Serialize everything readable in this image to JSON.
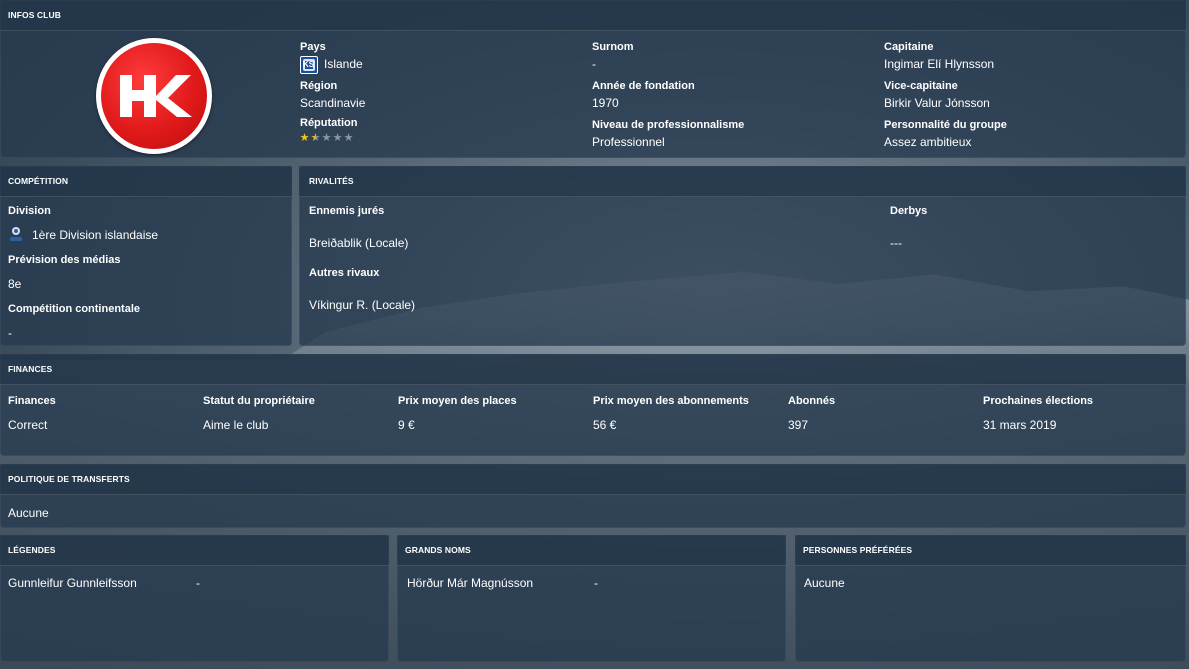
{
  "club_info": {
    "title": "INFOS CLUB",
    "country_label": "Pays",
    "country_value": "Islande",
    "region_label": "Région",
    "region_value": "Scandinavie",
    "reputation_label": "Réputation",
    "reputation_stars": 1.5,
    "reputation_max": 5,
    "nickname_label": "Surnom",
    "nickname_value": "-",
    "founded_label": "Année de fondation",
    "founded_value": "1970",
    "professionalism_label": "Niveau de professionnalisme",
    "professionalism_value": "Professionnel",
    "captain_label": "Capitaine",
    "captain_value": "Ingimar Elí Hlynsson",
    "vice_captain_label": "Vice-capitaine",
    "vice_captain_value": "Birkir Valur Jónsson",
    "personality_label": "Personnalité du groupe",
    "personality_value": "Assez ambitieux",
    "crest_text": "HK",
    "crest_color": "#e01a1a"
  },
  "competition": {
    "title": "COMPÉTITION",
    "division_label": "Division",
    "division_value": "1ère Division islandaise",
    "media_label": "Prévision des médias",
    "media_value": "8e",
    "continental_label": "Compétition continentale",
    "continental_value": "-"
  },
  "rivalries": {
    "title": "RIVALITÉS",
    "sworn_label": "Ennemis jurés",
    "sworn_value": "Breiðablik (Locale)",
    "other_label": "Autres rivaux",
    "other_value": "Víkingur R. (Locale)",
    "derbys_label": "Derbys",
    "derbys_value": "---"
  },
  "finances": {
    "title": "FINANCES",
    "columns": [
      {
        "label": "Finances",
        "value": "Correct"
      },
      {
        "label": "Statut du propriétaire",
        "value": "Aime le club"
      },
      {
        "label": "Prix moyen des places",
        "value": "9 €"
      },
      {
        "label": "Prix moyen des abonnements",
        "value": "56 €"
      },
      {
        "label": "Abonnés",
        "value": "397"
      },
      {
        "label": "Prochaines élections",
        "value": "31 mars 2019"
      }
    ]
  },
  "transfers": {
    "title": "POLITIQUE DE TRANSFERTS",
    "value": "Aucune"
  },
  "legends": {
    "title": "LÉGENDES",
    "name": "Gunnleifur Gunnleifsson",
    "extra": "-"
  },
  "big_names": {
    "title": "GRANDS NOMS",
    "name": "Hörður Már Magnússon",
    "extra": "-"
  },
  "favorites": {
    "title": "PERSONNES PRÉFÉRÉES",
    "value": "Aucune"
  }
}
